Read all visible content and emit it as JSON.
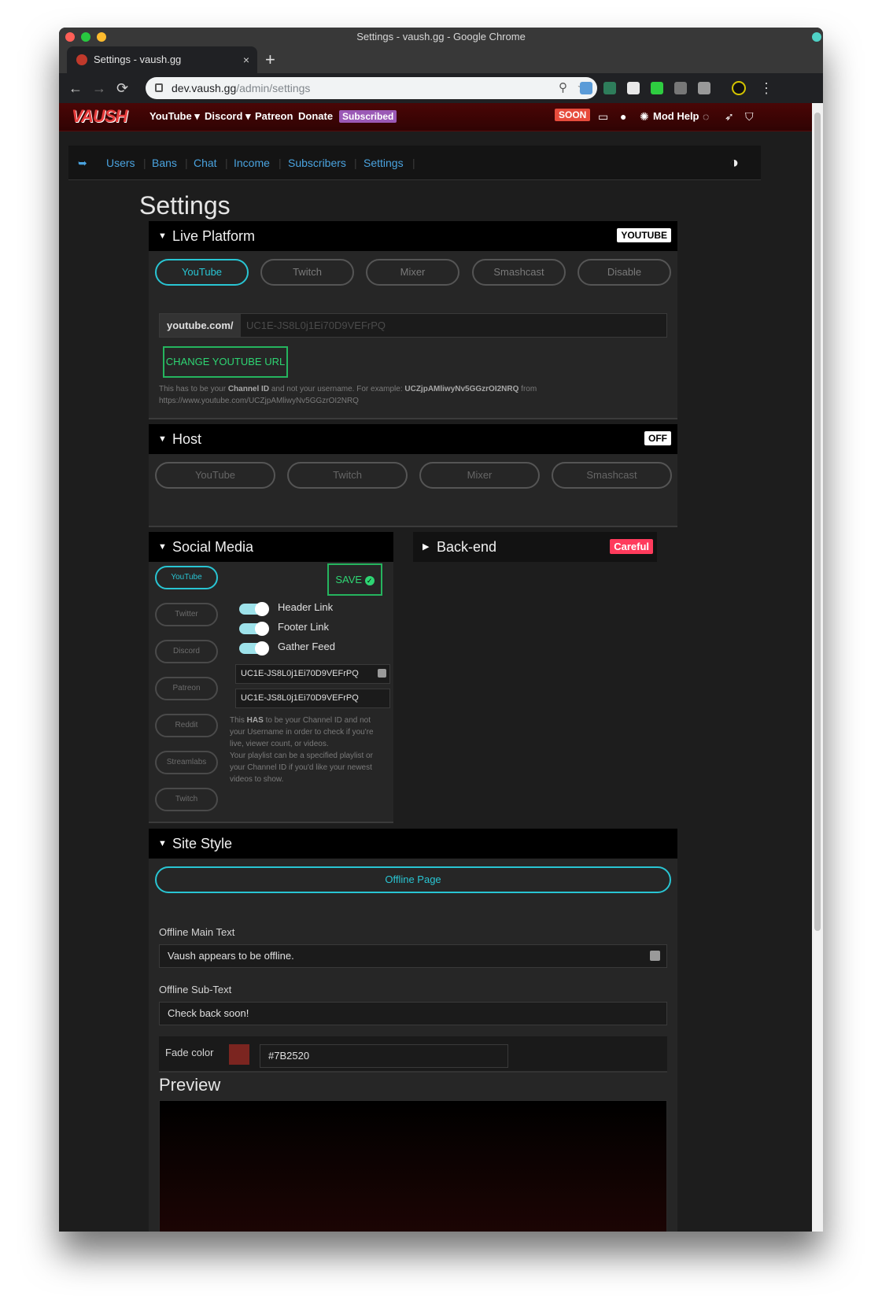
{
  "window": {
    "title": "Settings - vaush.gg - Google Chrome"
  },
  "tab": {
    "title": "Settings - vaush.gg",
    "close": "×",
    "new_tab": "+"
  },
  "toolbar": {
    "back": "←",
    "forward": "→",
    "reload": "⟳",
    "url_host": "dev.vaush.gg",
    "url_path": "/admin/settings",
    "zoom": "⚲",
    "star": "☆",
    "menu": "⋮"
  },
  "site_nav": {
    "logo": "VAUSH",
    "items": [
      "YouTube ▾",
      "Discord ▾",
      "Patreon",
      "Donate"
    ],
    "subscribed_badge": "Subscribed",
    "soon_badge": "SOON",
    "mod_help": "Mod Help"
  },
  "admin_nav": {
    "items": [
      "Users",
      "Bans",
      "Chat",
      "Income",
      "Subscribers",
      "Settings"
    ]
  },
  "page": {
    "title": "Settings"
  },
  "live_platform": {
    "title": "Live Platform",
    "badge": "YOUTUBE",
    "options": [
      "YouTube",
      "Twitch",
      "Mixer",
      "Smashcast",
      "Disable"
    ],
    "active": "YouTube",
    "url_prefix": "youtube.com/",
    "url_placeholder": "UC1E-JS8L0j1Ei70D9VEFrPQ",
    "change_button": "CHANGE YOUTUBE URL",
    "help_line1_pre": "This has to be your ",
    "help_line1_b1": "Channel ID",
    "help_line1_mid": " and not your username. For example: ",
    "help_line1_b2": "UCZjpAMliwyNv5GGzrOI2NRQ",
    "help_line1_post": " from",
    "help_line2": "https://www.youtube.com/UCZjpAMliwyNv5GGzrOI2NRQ"
  },
  "host": {
    "title": "Host",
    "badge": "OFF",
    "options": [
      "YouTube",
      "Twitch",
      "Mixer",
      "Smashcast"
    ]
  },
  "social_media": {
    "title": "Social Media",
    "platforms": [
      "YouTube",
      "Twitter",
      "Discord",
      "Patreon",
      "Reddit",
      "Streamlabs",
      "Twitch"
    ],
    "active": "YouTube",
    "save_button": "SAVE",
    "toggles": [
      "Header Link",
      "Footer Link",
      "Gather Feed"
    ],
    "channel_id_value": "UC1E-JS8L0j1Ei70D9VEFrPQ",
    "playlist_value": "UC1E-JS8L0j1Ei70D9VEFrPQ",
    "help_l1_pre": "This ",
    "help_l1_b": "HAS",
    "help_l1_post": " to be your Channel ID and not",
    "help_l2": "your Username in order to check if you're",
    "help_l3": "live, viewer count, or videos.",
    "help_l4": "Your playlist can be a specified playlist or",
    "help_l5": "your Channel ID if you'd like your newest",
    "help_l6": "videos to show."
  },
  "backend": {
    "title": "Back-end",
    "badge": "Careful"
  },
  "site_style": {
    "title": "Site Style",
    "tab": "Offline Page",
    "main_text_label": "Offline Main Text",
    "main_text_value": "Vaush appears to be offline.",
    "sub_text_label": "Offline Sub-Text",
    "sub_text_value": "Check back soon!",
    "fade_label": "Fade color",
    "fade_value": "#7B2520",
    "preview_title": "Preview"
  },
  "colors": {
    "accent": "#29c5d3",
    "save_green": "#2ed573",
    "nav_red": "#3c0404",
    "fade": "#7B2520"
  }
}
